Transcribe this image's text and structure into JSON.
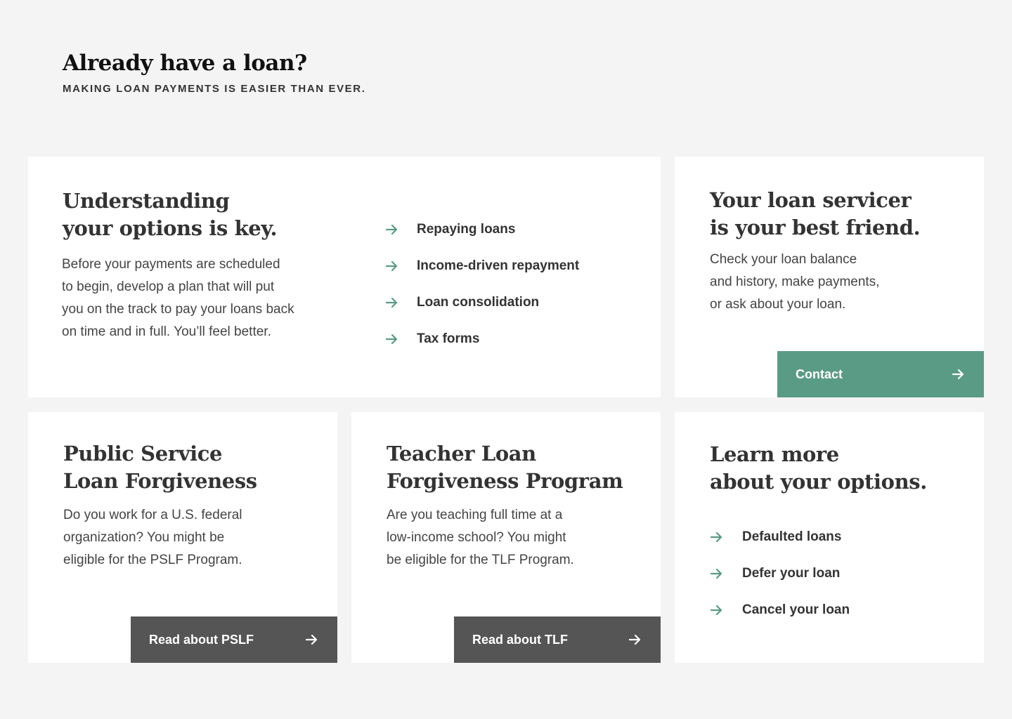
{
  "header": {
    "title": "Already have a loan?",
    "subtitle": "Making loan payments is easier than ever."
  },
  "understanding": {
    "title_line1": "Understanding",
    "title_line2": "your options is key.",
    "body_lines": [
      "Before your payments are scheduled",
      "to begin, develop a plan that will put",
      "you on the track to pay your loans back",
      "on time and in full. You’ll feel better."
    ],
    "links": [
      "Repaying loans",
      "Income-driven repayment",
      "Loan consolidation",
      "Tax forms"
    ]
  },
  "servicer": {
    "title_line1": "Your loan servicer",
    "title_line2": "is your best friend.",
    "body_lines": [
      "Check your loan balance",
      "and history, make payments,",
      "or ask about your loan."
    ],
    "button_label": "Contact"
  },
  "pslf": {
    "title_line1": "Public Service",
    "title_line2": "Loan Forgiveness",
    "body_lines": [
      "Do you work for a U.S. federal",
      "organization? You might be",
      "eligible for the PSLF Program."
    ],
    "button_label": "Read about PSLF"
  },
  "tlf": {
    "title_line1": "Teacher Loan",
    "title_line2": "Forgiveness Program",
    "body_lines": [
      "Are you teaching full time at a",
      "low-income school? You might",
      "be eligible for the TLF Program."
    ],
    "button_label": "Read about TLF"
  },
  "learn": {
    "title_line1": "Learn more",
    "title_line2": "about your options.",
    "links": [
      "Defaulted loans",
      "Defer your loan",
      "Cancel your loan"
    ]
  },
  "icons": {
    "arrow": "arrow-right-icon"
  },
  "colors": {
    "background": "#f4f4f4",
    "card": "#ffffff",
    "accent_green": "#5a9b85",
    "button_dark": "#555555",
    "text": "#333333"
  }
}
